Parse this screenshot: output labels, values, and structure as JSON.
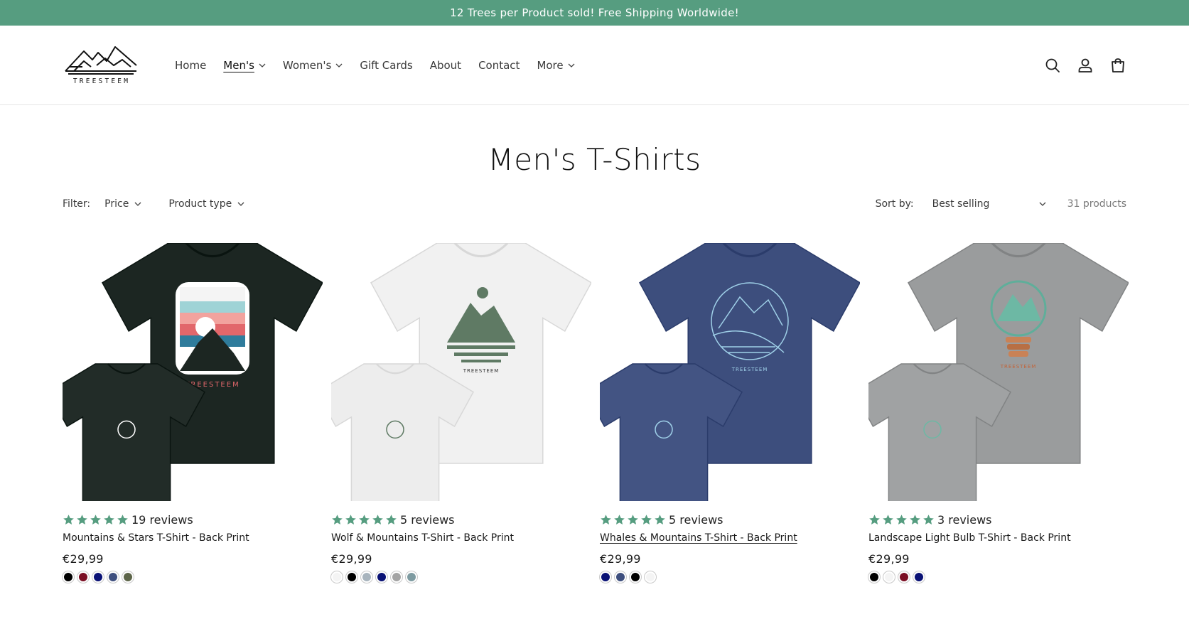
{
  "announcement": "12 Trees per Product sold! Free Shipping Worldwide!",
  "brand": {
    "name": "TREESTEEM"
  },
  "nav": [
    {
      "label": "Home",
      "dropdown": false,
      "active": false
    },
    {
      "label": "Men's",
      "dropdown": true,
      "active": true
    },
    {
      "label": "Women's",
      "dropdown": true,
      "active": false
    },
    {
      "label": "Gift Cards",
      "dropdown": false,
      "active": false
    },
    {
      "label": "About",
      "dropdown": false,
      "active": false
    },
    {
      "label": "Contact",
      "dropdown": false,
      "active": false
    },
    {
      "label": "More",
      "dropdown": true,
      "active": false
    }
  ],
  "header_icons": [
    "search-icon",
    "account-icon",
    "cart-icon"
  ],
  "page_title": "Men's T-Shirts",
  "filter": {
    "label": "Filter:",
    "price": "Price",
    "product_type": "Product type",
    "sort_label": "Sort by:",
    "sort_value": "Best selling",
    "count": "31 products"
  },
  "colors": {
    "accent": "#569d80",
    "star": "#569d80"
  },
  "products": [
    {
      "name": "Mountains & Stars T-Shirt - Back Print",
      "reviews": "19 reviews",
      "rating": 5,
      "price": "€29,99",
      "shirt_color": "#1c2622",
      "swatches": [
        "#000000",
        "#7a0e23",
        "#0a1275",
        "#3e4f7e",
        "#5d6549"
      ]
    },
    {
      "name": "Wolf & Mountains T-Shirt - Back Print",
      "reviews": "5 reviews",
      "rating": 5,
      "price": "€29,99",
      "shirt_color": "#f1f1f1",
      "swatches": [
        "#f4f4f4",
        "#000000",
        "#a8b4bd",
        "#0a1275",
        "#a4a4a4",
        "#7e9ba1"
      ]
    },
    {
      "name": "Whales & Mountains T-Shirt - Back Print",
      "reviews": "5 reviews",
      "rating": 5,
      "price": "€29,99",
      "shirt_color": "#3d4e7d",
      "swatches": [
        "#0a1275",
        "#3e4f7e",
        "#000000",
        "#f4f4f4"
      ]
    },
    {
      "name": "Landscape Light Bulb T-Shirt - Back Print",
      "reviews": "3 reviews",
      "rating": 5,
      "price": "€29,99",
      "shirt_color": "#9a9c9d",
      "swatches": [
        "#000000",
        "#f4f4f4",
        "#7a0e23",
        "#0a1275"
      ]
    }
  ]
}
